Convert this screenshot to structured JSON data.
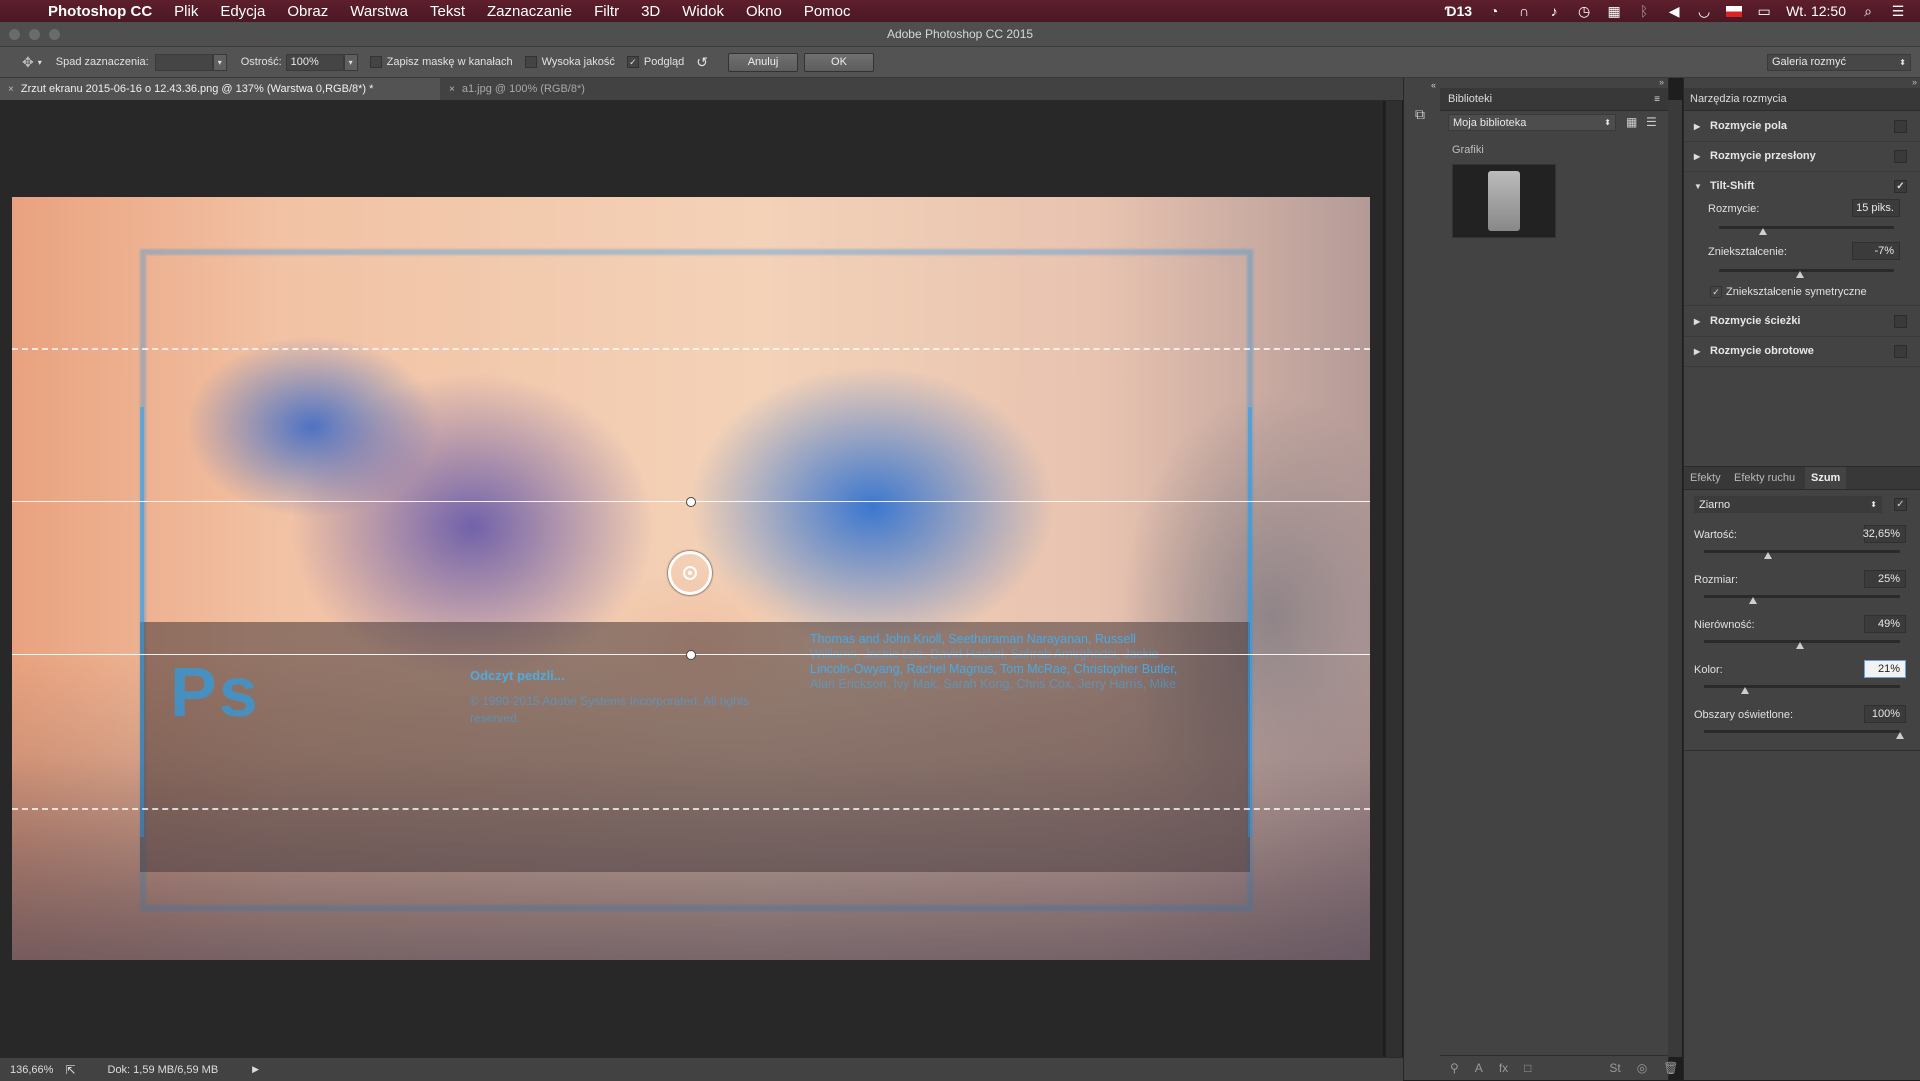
{
  "menubar": {
    "app_name": "Photoshop CC",
    "items": [
      "Plik",
      "Edycja",
      "Obraz",
      "Warstwa",
      "Tekst",
      "Zaznaczanie",
      "Filtr",
      "3D",
      "Widok",
      "Okno",
      "Pomoc"
    ],
    "status_count": "13",
    "clock": "Wt. 12:50"
  },
  "window": {
    "title": "Adobe Photoshop CC 2015"
  },
  "options": {
    "spad_label": "Spad zaznaczenia:",
    "ostrosc_label": "Ostrość:",
    "ostrosc_value": "100%",
    "zapisz_label": "Zapisz maskę w kanałach",
    "wysoka_label": "Wysoka jakość",
    "podglad_label": "Podgląd",
    "podglad_checked": true,
    "cancel_label": "Anuluj",
    "ok_label": "OK",
    "workspace": "Galeria rozmyć"
  },
  "tabs": [
    {
      "label": "Zrzut ekranu 2015-06-16 o 12.43.36.png @ 137% (Warstwa 0,RGB/8*) *",
      "active": true
    },
    {
      "label": "a1.jpg @ 100% (RGB/8*)",
      "active": false
    }
  ],
  "canvas": {
    "ps_logo": "Ps",
    "read_more": "Odczyt pedzli...",
    "copyright": "© 1990-2015 Adobe Systems Incorporated. All rights reserved.",
    "credits_lines": [
      "Thomas and John Knoll, Seetharaman Narayanan, Russell",
      "Williams, Jackie Lee, David Hackel, Sohrab Amirghodsi, Jackie",
      "Lincoln-Owyang, Rachel Magnus, Tom McRae, Christopher Butler,",
      "Alan Erickson, Ivy Mak, Sarah Kong, Chris Cox, Jerry Harris, Mike"
    ]
  },
  "status": {
    "zoom": "136,66%",
    "doc": "Dok: 1,59 MB/6,59 MB"
  },
  "libraries": {
    "header": "Biblioteki",
    "library_select": "Moja biblioteka",
    "section": "Grafiki"
  },
  "blur_tools": {
    "header": "Narzędzia rozmycia",
    "items": [
      {
        "label": "Rozmycie pola",
        "expanded": false,
        "checked": false
      },
      {
        "label": "Rozmycie przesłony",
        "expanded": false,
        "checked": false
      },
      {
        "label": "Tilt-Shift",
        "expanded": true,
        "checked": true
      },
      {
        "label": "Rozmycie ścieżki",
        "expanded": false,
        "checked": false
      },
      {
        "label": "Rozmycie obrotowe",
        "expanded": false,
        "checked": false
      }
    ],
    "tiltshift": {
      "blur_label": "Rozmycie:",
      "blur_value": "15 piks.",
      "blur_level": 0.25,
      "distortion_label": "Zniekształcenie:",
      "distortion_value": "-7%",
      "distortion_level": 0.46,
      "symmetric_label": "Zniekształcenie symetryczne",
      "symmetric_checked": true
    }
  },
  "effects": {
    "tabs": [
      "Efekty",
      "Efekty ruchu",
      "Szum"
    ],
    "active_tab": "Szum",
    "noise_type": "Ziarno",
    "sliders": [
      {
        "label": "Wartość:",
        "value": "32,65%",
        "level": 0.3265
      },
      {
        "label": "Rozmiar:",
        "value": "25%",
        "level": 0.25
      },
      {
        "label": "Nierówność:",
        "value": "49%",
        "level": 0.49
      },
      {
        "label": "Kolor:",
        "value": "21%",
        "level": 0.21
      },
      {
        "label": "Obszary oświetlone:",
        "value": "100%",
        "level": 1.0
      }
    ]
  },
  "icons": [
    "apple-icon",
    "tool-preset-icon",
    "refresh-icon",
    "search-icon",
    "notification-icon",
    "wifi-icon",
    "battery-icon",
    "grid-view-icon",
    "list-view-icon",
    "panel-menu-icon"
  ]
}
